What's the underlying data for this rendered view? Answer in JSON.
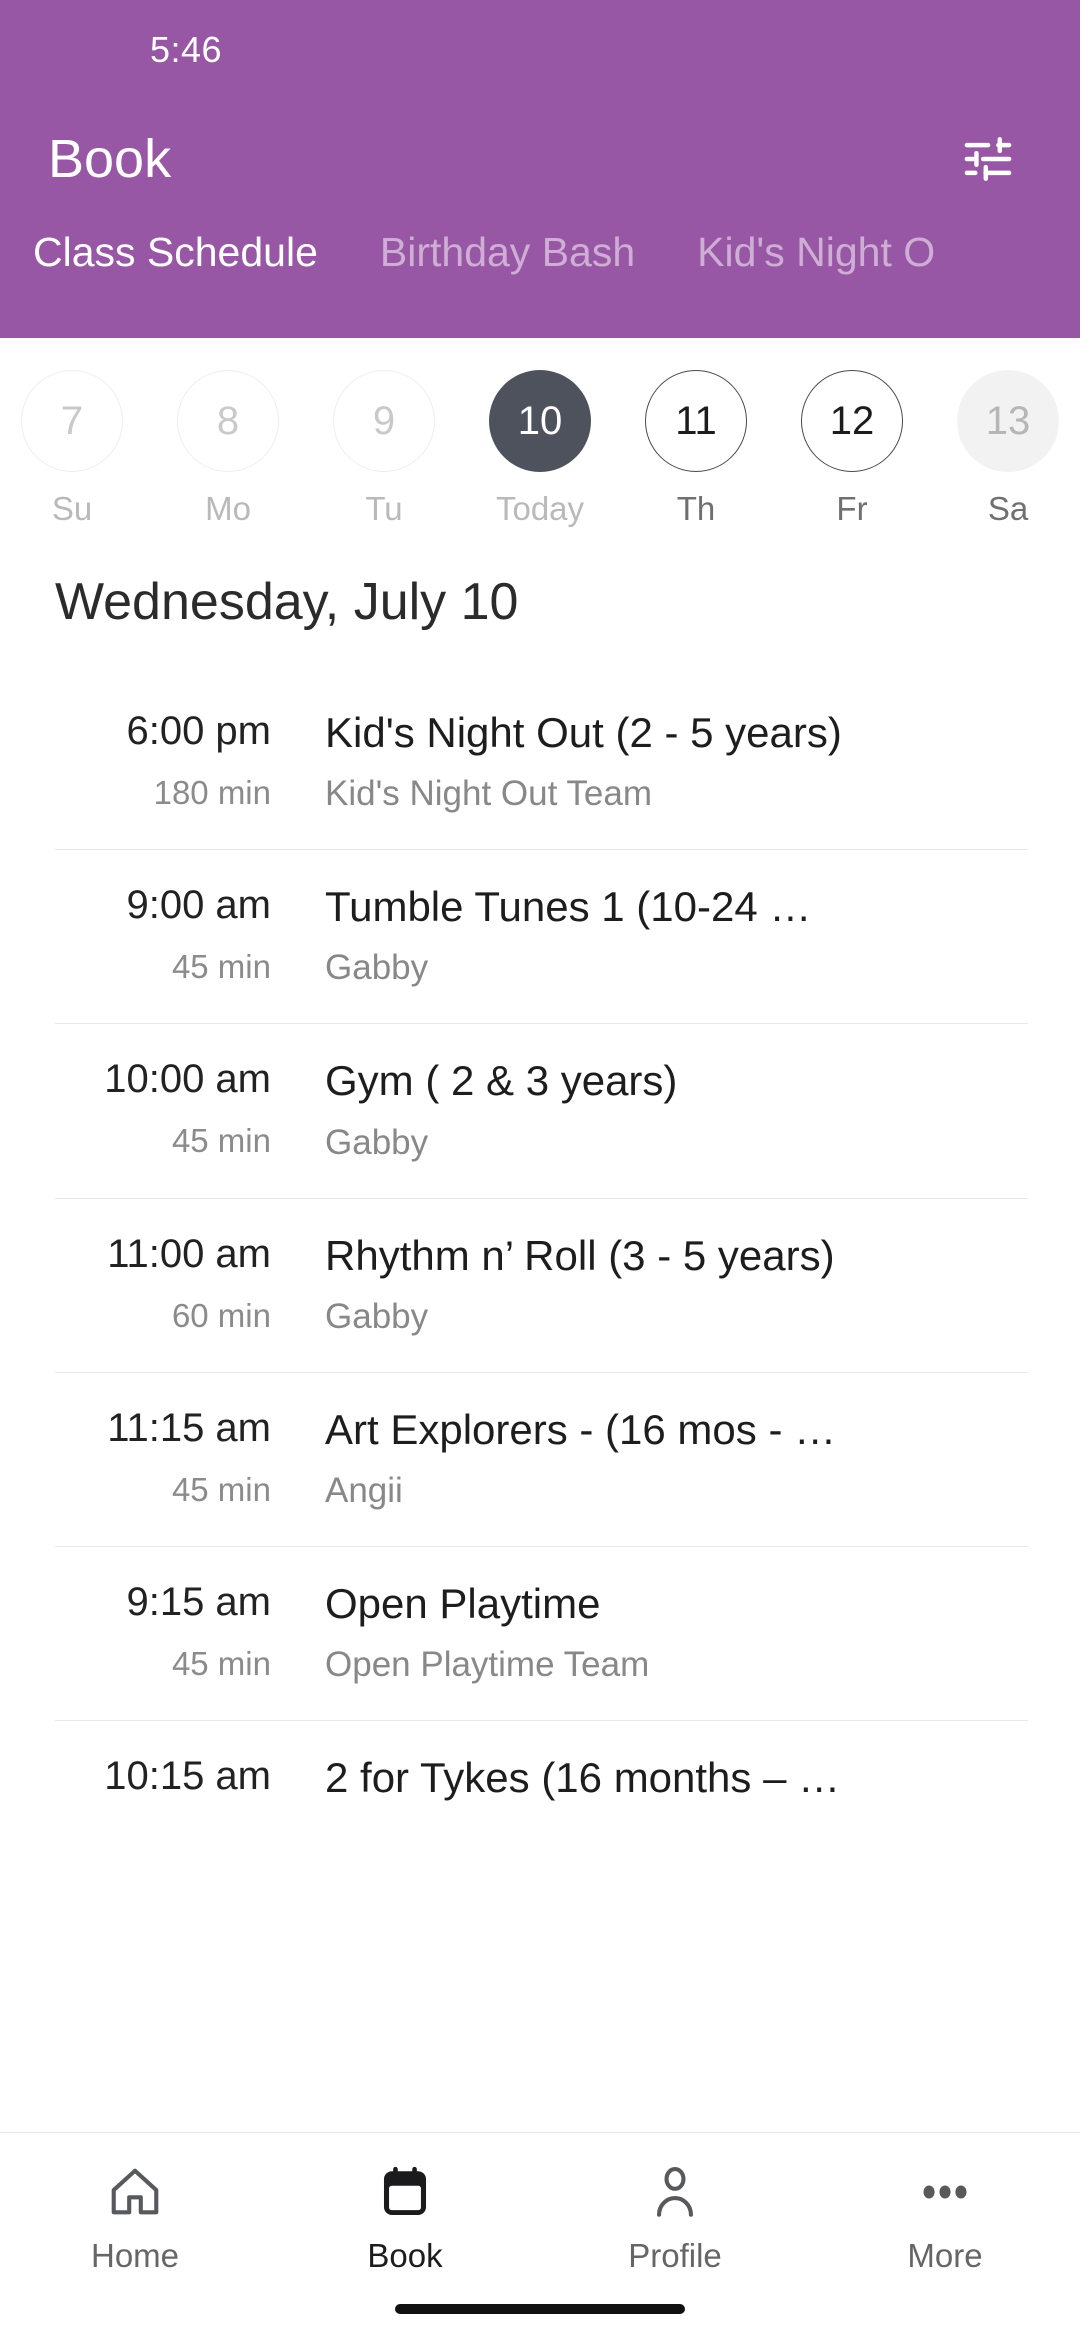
{
  "statusbar": {
    "time": "5:46"
  },
  "appbar": {
    "title": "Book",
    "filter_icon": "tune-sliders-icon"
  },
  "theme": {
    "header_purple": "#9857A5",
    "selected_day": "#4D525C",
    "muted_text": "#8b8b8b"
  },
  "tabs": [
    {
      "label": "Class Schedule",
      "active": true
    },
    {
      "label": "Birthday Bash",
      "active": false
    },
    {
      "label": "Kid's Night O",
      "active": false
    }
  ],
  "date_strip": [
    {
      "num": "7",
      "label": "Su",
      "state": "disabled"
    },
    {
      "num": "8",
      "label": "Mo",
      "state": "disabled"
    },
    {
      "num": "9",
      "label": "Tu",
      "state": "disabled"
    },
    {
      "num": "10",
      "label": "Today",
      "state": "selected"
    },
    {
      "num": "11",
      "label": "Th",
      "state": "active"
    },
    {
      "num": "12",
      "label": "Fr",
      "state": "active"
    },
    {
      "num": "13",
      "label": "Sa",
      "state": "muted"
    }
  ],
  "day_heading": "Wednesday, July 10",
  "classes": [
    {
      "time": "6:00 pm",
      "duration": "180 min",
      "title": "Kid's Night Out (2 - 5 years)",
      "instructor": "Kid's Night Out Team"
    },
    {
      "time": "9:00 am",
      "duration": "45 min",
      "title": "Tumble Tunes 1 (10-24 …",
      "instructor": "Gabby"
    },
    {
      "time": "10:00 am",
      "duration": "45 min",
      "title": "Gym ( 2 & 3 years)",
      "instructor": "Gabby"
    },
    {
      "time": "11:00 am",
      "duration": "60 min",
      "title": "Rhythm n’ Roll (3 - 5 years)",
      "instructor": "Gabby"
    },
    {
      "time": "11:15 am",
      "duration": "45 min",
      "title": "Art Explorers - (16 mos - …",
      "instructor": "Angii"
    },
    {
      "time": "9:15 am",
      "duration": "45 min",
      "title": "Open Playtime",
      "instructor": "Open Playtime Team"
    },
    {
      "time": "10:15 am",
      "duration": "",
      "title": "2 for Tykes (16 months – …",
      "instructor": ""
    }
  ],
  "bottom_nav": [
    {
      "label": "Home",
      "icon": "home-icon",
      "active": false
    },
    {
      "label": "Book",
      "icon": "calendar-icon",
      "active": true
    },
    {
      "label": "Profile",
      "icon": "person-icon",
      "active": false
    },
    {
      "label": "More",
      "icon": "ellipsis-icon",
      "active": false
    }
  ]
}
